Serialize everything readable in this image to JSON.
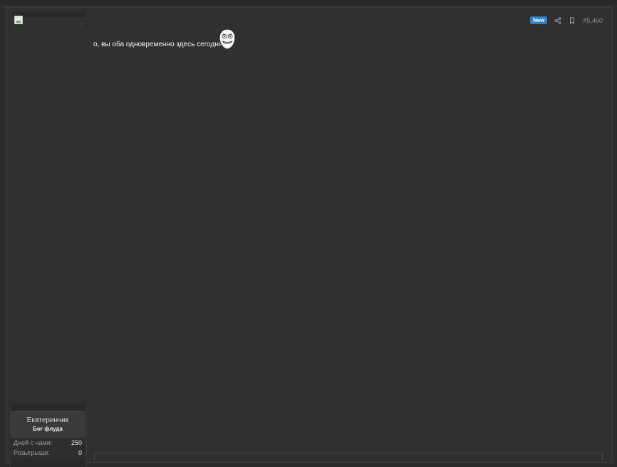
{
  "post": {
    "message": "о, вы оба одновременно здесь сегодня",
    "badge": "New",
    "number": "#5,460",
    "icons": {
      "share": "share-icon",
      "bookmark": "bookmark-icon",
      "smiley": "rage-face-icon",
      "avatar": "broken-image-icon"
    }
  },
  "user": {
    "name": "Екатеринчик",
    "title": "Бог флуда",
    "stats": [
      {
        "label": "Дней с нами:",
        "value": "250"
      },
      {
        "label": "Розыгрыши:",
        "value": "0"
      }
    ]
  },
  "colors": {
    "background": "#2b2b2b",
    "panel": "#303030",
    "badge": "#2f7fc1"
  }
}
